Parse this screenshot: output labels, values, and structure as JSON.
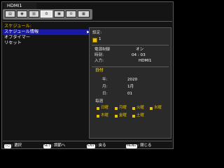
{
  "header": {
    "input_label": "HDMI1"
  },
  "toolbar": {
    "icons": [
      "picture-icon",
      "sound-icon",
      "setup-icon",
      "schedule-icon",
      "network-icon",
      "protect-icon",
      "option-icon"
    ],
    "glyphs": [
      "▤",
      "◉",
      "▥",
      "⏲",
      "▣",
      "⊙",
      "▦"
    ],
    "selected_index": 3
  },
  "menu": {
    "current": "スケジュール:",
    "items": [
      {
        "label": "スケジュール情報",
        "selected": true,
        "has_arrow": true,
        "arrow": "▶"
      },
      {
        "label": "オフタイマー",
        "selected": false
      },
      {
        "label": "リセット",
        "selected": false
      }
    ]
  },
  "panel": {
    "setting_label": "設定:",
    "slot_number": "1",
    "power_label": "電源制御",
    "power_value": "オン",
    "time_label": "時刻:",
    "time_value": "04 : 03",
    "input_label": "入力:",
    "input_value": "HDMI1",
    "date_section": "日付",
    "year_label": "年:",
    "year_value": "2020",
    "month_label": "月:",
    "month_value": "1月",
    "day_label": "日:",
    "day_value": "01",
    "weekly_label": "毎週",
    "days": [
      "日曜",
      "月曜",
      "火曜",
      "水曜",
      "木曜",
      "金曜",
      "土曜"
    ]
  },
  "footer": {
    "items": [
      {
        "key": "◇○",
        "label": ": 選択"
      },
      {
        "key": "SET",
        "label": ": 調節へ"
      },
      {
        "key": "EXIT",
        "label": ": 戻る"
      },
      {
        "key": "MENU",
        "label": ": 閉じる"
      }
    ]
  },
  "colors": {
    "accent_yellow": "#e6c200",
    "selection_blue": "#1a1aa8",
    "panel_bg": "#2a2a2a"
  }
}
